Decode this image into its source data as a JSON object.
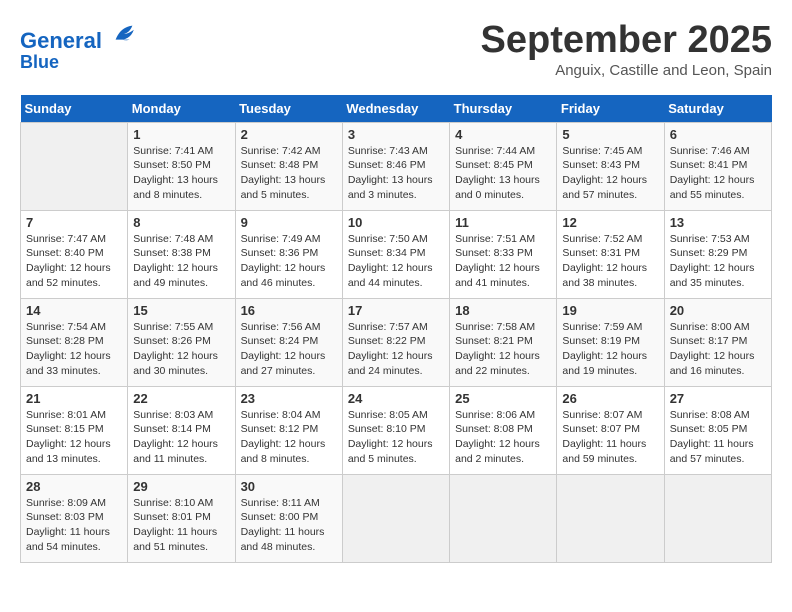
{
  "header": {
    "logo_line1": "General",
    "logo_line2": "Blue",
    "month_title": "September 2025",
    "location": "Anguix, Castille and Leon, Spain"
  },
  "weekdays": [
    "Sunday",
    "Monday",
    "Tuesday",
    "Wednesday",
    "Thursday",
    "Friday",
    "Saturday"
  ],
  "weeks": [
    [
      {
        "day": "",
        "sunrise": "",
        "sunset": "",
        "daylight": ""
      },
      {
        "day": "1",
        "sunrise": "Sunrise: 7:41 AM",
        "sunset": "Sunset: 8:50 PM",
        "daylight": "Daylight: 13 hours and 8 minutes."
      },
      {
        "day": "2",
        "sunrise": "Sunrise: 7:42 AM",
        "sunset": "Sunset: 8:48 PM",
        "daylight": "Daylight: 13 hours and 5 minutes."
      },
      {
        "day": "3",
        "sunrise": "Sunrise: 7:43 AM",
        "sunset": "Sunset: 8:46 PM",
        "daylight": "Daylight: 13 hours and 3 minutes."
      },
      {
        "day": "4",
        "sunrise": "Sunrise: 7:44 AM",
        "sunset": "Sunset: 8:45 PM",
        "daylight": "Daylight: 13 hours and 0 minutes."
      },
      {
        "day": "5",
        "sunrise": "Sunrise: 7:45 AM",
        "sunset": "Sunset: 8:43 PM",
        "daylight": "Daylight: 12 hours and 57 minutes."
      },
      {
        "day": "6",
        "sunrise": "Sunrise: 7:46 AM",
        "sunset": "Sunset: 8:41 PM",
        "daylight": "Daylight: 12 hours and 55 minutes."
      }
    ],
    [
      {
        "day": "7",
        "sunrise": "Sunrise: 7:47 AM",
        "sunset": "Sunset: 8:40 PM",
        "daylight": "Daylight: 12 hours and 52 minutes."
      },
      {
        "day": "8",
        "sunrise": "Sunrise: 7:48 AM",
        "sunset": "Sunset: 8:38 PM",
        "daylight": "Daylight: 12 hours and 49 minutes."
      },
      {
        "day": "9",
        "sunrise": "Sunrise: 7:49 AM",
        "sunset": "Sunset: 8:36 PM",
        "daylight": "Daylight: 12 hours and 46 minutes."
      },
      {
        "day": "10",
        "sunrise": "Sunrise: 7:50 AM",
        "sunset": "Sunset: 8:34 PM",
        "daylight": "Daylight: 12 hours and 44 minutes."
      },
      {
        "day": "11",
        "sunrise": "Sunrise: 7:51 AM",
        "sunset": "Sunset: 8:33 PM",
        "daylight": "Daylight: 12 hours and 41 minutes."
      },
      {
        "day": "12",
        "sunrise": "Sunrise: 7:52 AM",
        "sunset": "Sunset: 8:31 PM",
        "daylight": "Daylight: 12 hours and 38 minutes."
      },
      {
        "day": "13",
        "sunrise": "Sunrise: 7:53 AM",
        "sunset": "Sunset: 8:29 PM",
        "daylight": "Daylight: 12 hours and 35 minutes."
      }
    ],
    [
      {
        "day": "14",
        "sunrise": "Sunrise: 7:54 AM",
        "sunset": "Sunset: 8:28 PM",
        "daylight": "Daylight: 12 hours and 33 minutes."
      },
      {
        "day": "15",
        "sunrise": "Sunrise: 7:55 AM",
        "sunset": "Sunset: 8:26 PM",
        "daylight": "Daylight: 12 hours and 30 minutes."
      },
      {
        "day": "16",
        "sunrise": "Sunrise: 7:56 AM",
        "sunset": "Sunset: 8:24 PM",
        "daylight": "Daylight: 12 hours and 27 minutes."
      },
      {
        "day": "17",
        "sunrise": "Sunrise: 7:57 AM",
        "sunset": "Sunset: 8:22 PM",
        "daylight": "Daylight: 12 hours and 24 minutes."
      },
      {
        "day": "18",
        "sunrise": "Sunrise: 7:58 AM",
        "sunset": "Sunset: 8:21 PM",
        "daylight": "Daylight: 12 hours and 22 minutes."
      },
      {
        "day": "19",
        "sunrise": "Sunrise: 7:59 AM",
        "sunset": "Sunset: 8:19 PM",
        "daylight": "Daylight: 12 hours and 19 minutes."
      },
      {
        "day": "20",
        "sunrise": "Sunrise: 8:00 AM",
        "sunset": "Sunset: 8:17 PM",
        "daylight": "Daylight: 12 hours and 16 minutes."
      }
    ],
    [
      {
        "day": "21",
        "sunrise": "Sunrise: 8:01 AM",
        "sunset": "Sunset: 8:15 PM",
        "daylight": "Daylight: 12 hours and 13 minutes."
      },
      {
        "day": "22",
        "sunrise": "Sunrise: 8:03 AM",
        "sunset": "Sunset: 8:14 PM",
        "daylight": "Daylight: 12 hours and 11 minutes."
      },
      {
        "day": "23",
        "sunrise": "Sunrise: 8:04 AM",
        "sunset": "Sunset: 8:12 PM",
        "daylight": "Daylight: 12 hours and 8 minutes."
      },
      {
        "day": "24",
        "sunrise": "Sunrise: 8:05 AM",
        "sunset": "Sunset: 8:10 PM",
        "daylight": "Daylight: 12 hours and 5 minutes."
      },
      {
        "day": "25",
        "sunrise": "Sunrise: 8:06 AM",
        "sunset": "Sunset: 8:08 PM",
        "daylight": "Daylight: 12 hours and 2 minutes."
      },
      {
        "day": "26",
        "sunrise": "Sunrise: 8:07 AM",
        "sunset": "Sunset: 8:07 PM",
        "daylight": "Daylight: 11 hours and 59 minutes."
      },
      {
        "day": "27",
        "sunrise": "Sunrise: 8:08 AM",
        "sunset": "Sunset: 8:05 PM",
        "daylight": "Daylight: 11 hours and 57 minutes."
      }
    ],
    [
      {
        "day": "28",
        "sunrise": "Sunrise: 8:09 AM",
        "sunset": "Sunset: 8:03 PM",
        "daylight": "Daylight: 11 hours and 54 minutes."
      },
      {
        "day": "29",
        "sunrise": "Sunrise: 8:10 AM",
        "sunset": "Sunset: 8:01 PM",
        "daylight": "Daylight: 11 hours and 51 minutes."
      },
      {
        "day": "30",
        "sunrise": "Sunrise: 8:11 AM",
        "sunset": "Sunset: 8:00 PM",
        "daylight": "Daylight: 11 hours and 48 minutes."
      },
      {
        "day": "",
        "sunrise": "",
        "sunset": "",
        "daylight": ""
      },
      {
        "day": "",
        "sunrise": "",
        "sunset": "",
        "daylight": ""
      },
      {
        "day": "",
        "sunrise": "",
        "sunset": "",
        "daylight": ""
      },
      {
        "day": "",
        "sunrise": "",
        "sunset": "",
        "daylight": ""
      }
    ]
  ]
}
